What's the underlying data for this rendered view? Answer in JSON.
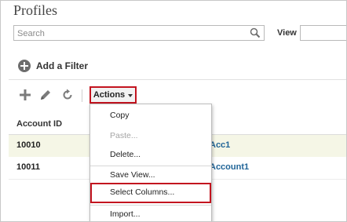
{
  "page": {
    "title": "Profiles"
  },
  "search": {
    "placeholder": "Search"
  },
  "view": {
    "label": "View"
  },
  "filter": {
    "add_label": "Add a Filter"
  },
  "toolbar": {
    "add_icon": "plus-icon",
    "edit_icon": "pencil-icon",
    "refresh_icon": "refresh-icon",
    "actions_label": "Actions"
  },
  "table": {
    "columns": [
      "Account ID"
    ],
    "rows": [
      {
        "id": "10010",
        "name": "Acc1"
      },
      {
        "id": "10011",
        "name": "Account1"
      }
    ]
  },
  "actions_menu": {
    "items": [
      {
        "label": "Copy",
        "enabled": true
      },
      {
        "label": "Paste...",
        "enabled": false
      },
      {
        "label": "Delete...",
        "enabled": true
      },
      {
        "label": "Save View...",
        "enabled": true
      },
      {
        "label": "Select Columns...",
        "enabled": true
      },
      {
        "label": "Import...",
        "enabled": true
      }
    ]
  },
  "colors": {
    "highlight": "#c3141f",
    "link": "#1f6497",
    "selected_row": "#f5f6e6"
  }
}
